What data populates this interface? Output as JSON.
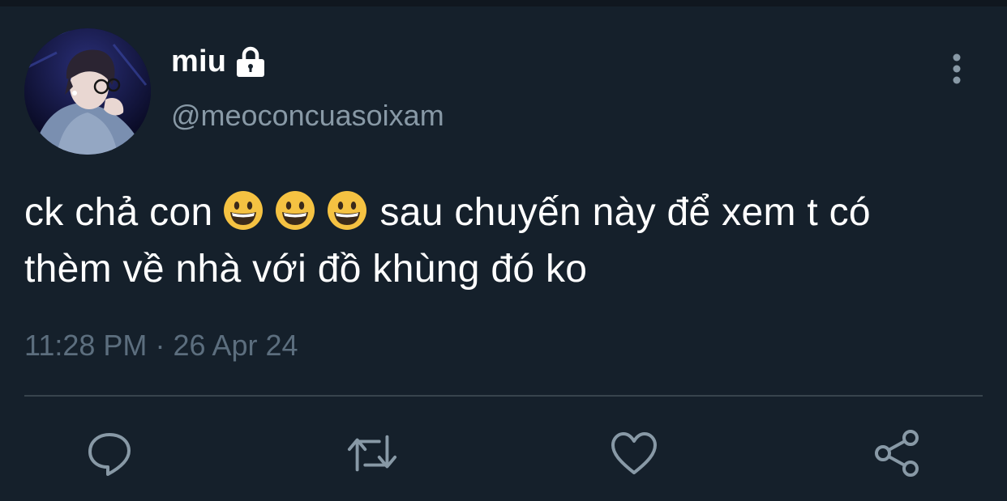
{
  "tweet": {
    "author": {
      "display_name": "miu",
      "handle": "@meoconcuasoixam",
      "protected_icon": "lock-icon"
    },
    "text_line1_before": "ck chả con",
    "emojis": [
      "😀",
      "😀",
      "😀"
    ],
    "text_line1_after": "sau chuyến này để xem t có",
    "text_line2": "thèm về nhà với đồ khùng đó ko",
    "time": "11:28 PM",
    "separator": "·",
    "date": "26 Apr 24"
  },
  "actions": {
    "icons": [
      "reply-icon",
      "retweet-icon",
      "like-icon",
      "share-icon"
    ]
  },
  "menu": {
    "icon": "more-vertical-icon"
  },
  "colors": {
    "background": "#15202b",
    "primary_text": "#ffffff",
    "secondary_text": "#8899a6",
    "timestamp_text": "#5c6e7e",
    "divider": "#38444d",
    "icon": "#8899a6",
    "emoji_face": "#f5c242"
  }
}
